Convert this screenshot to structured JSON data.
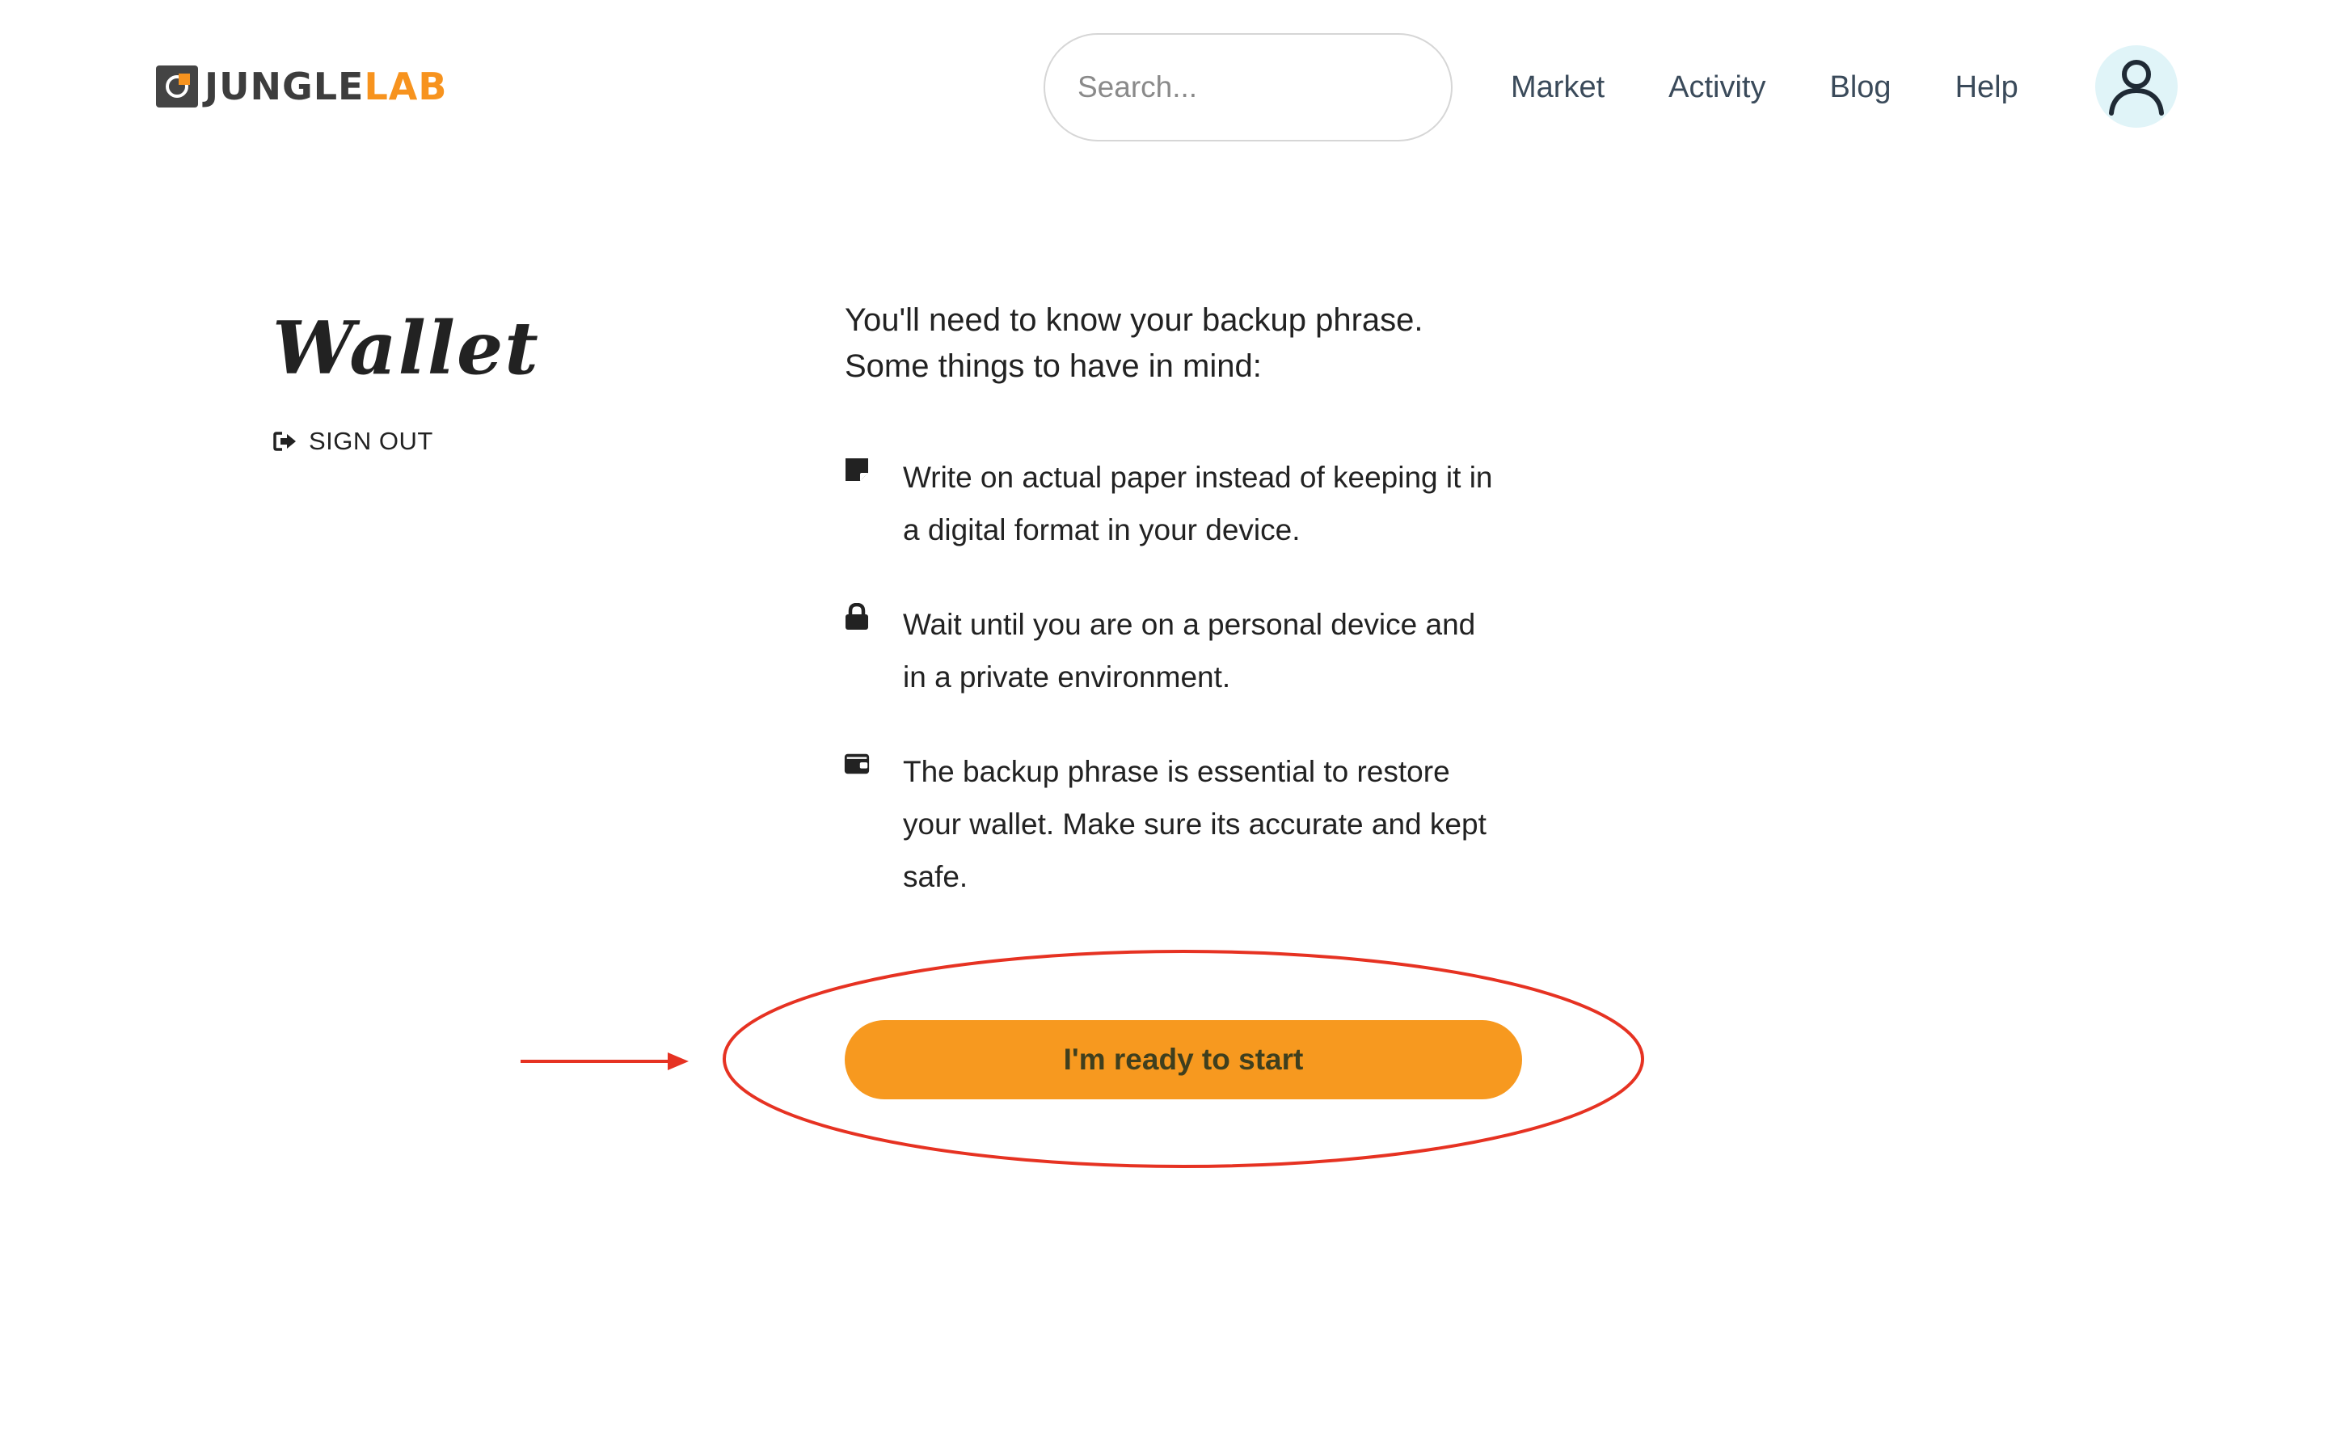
{
  "header": {
    "logo": {
      "part1": "JUNGLE",
      "part2": "LAB"
    },
    "search": {
      "placeholder": "Search..."
    },
    "nav": [
      {
        "label": "Market"
      },
      {
        "label": "Activity"
      },
      {
        "label": "Blog"
      },
      {
        "label": "Help"
      }
    ],
    "avatar_icon": "user-icon"
  },
  "sidebar": {
    "title": "Wallet",
    "signout_label": "SIGN OUT",
    "signout_icon": "sign-out-icon"
  },
  "main": {
    "intro_line1": "You'll need to know your backup phrase.",
    "intro_line2": "Some things to have in mind:",
    "tips": [
      {
        "icon": "sticky-note-icon",
        "line1": "Write on actual paper instead of keeping it in",
        "line2": "a digital format in your device."
      },
      {
        "icon": "lock-icon",
        "line1": "Wait until you are on a personal device and",
        "line2": "in a private environment."
      },
      {
        "icon": "wallet-icon",
        "line1": "The backup phrase is essential to restore",
        "line2": "your wallet. Make sure its accurate and kept",
        "line3": "safe."
      }
    ],
    "start_button_label": "I'm ready to start"
  },
  "colors": {
    "accent": "#f7931e",
    "button": "#f7991f",
    "annotation": "#e63222",
    "avatar_bg": "#e0f4f8"
  }
}
